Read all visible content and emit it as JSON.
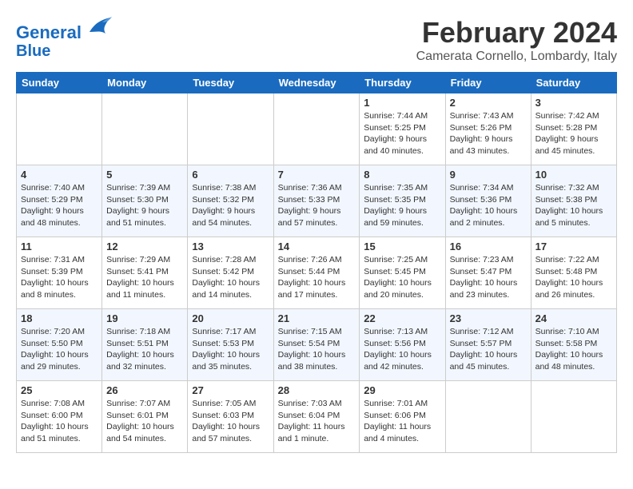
{
  "header": {
    "logo_line1": "General",
    "logo_line2": "Blue",
    "month": "February 2024",
    "location": "Camerata Cornello, Lombardy, Italy"
  },
  "weekdays": [
    "Sunday",
    "Monday",
    "Tuesday",
    "Wednesday",
    "Thursday",
    "Friday",
    "Saturday"
  ],
  "weeks": [
    [
      {
        "day": "",
        "info": ""
      },
      {
        "day": "",
        "info": ""
      },
      {
        "day": "",
        "info": ""
      },
      {
        "day": "",
        "info": ""
      },
      {
        "day": "1",
        "info": "Sunrise: 7:44 AM\nSunset: 5:25 PM\nDaylight: 9 hours\nand 40 minutes."
      },
      {
        "day": "2",
        "info": "Sunrise: 7:43 AM\nSunset: 5:26 PM\nDaylight: 9 hours\nand 43 minutes."
      },
      {
        "day": "3",
        "info": "Sunrise: 7:42 AM\nSunset: 5:28 PM\nDaylight: 9 hours\nand 45 minutes."
      }
    ],
    [
      {
        "day": "4",
        "info": "Sunrise: 7:40 AM\nSunset: 5:29 PM\nDaylight: 9 hours\nand 48 minutes."
      },
      {
        "day": "5",
        "info": "Sunrise: 7:39 AM\nSunset: 5:30 PM\nDaylight: 9 hours\nand 51 minutes."
      },
      {
        "day": "6",
        "info": "Sunrise: 7:38 AM\nSunset: 5:32 PM\nDaylight: 9 hours\nand 54 minutes."
      },
      {
        "day": "7",
        "info": "Sunrise: 7:36 AM\nSunset: 5:33 PM\nDaylight: 9 hours\nand 57 minutes."
      },
      {
        "day": "8",
        "info": "Sunrise: 7:35 AM\nSunset: 5:35 PM\nDaylight: 9 hours\nand 59 minutes."
      },
      {
        "day": "9",
        "info": "Sunrise: 7:34 AM\nSunset: 5:36 PM\nDaylight: 10 hours\nand 2 minutes."
      },
      {
        "day": "10",
        "info": "Sunrise: 7:32 AM\nSunset: 5:38 PM\nDaylight: 10 hours\nand 5 minutes."
      }
    ],
    [
      {
        "day": "11",
        "info": "Sunrise: 7:31 AM\nSunset: 5:39 PM\nDaylight: 10 hours\nand 8 minutes."
      },
      {
        "day": "12",
        "info": "Sunrise: 7:29 AM\nSunset: 5:41 PM\nDaylight: 10 hours\nand 11 minutes."
      },
      {
        "day": "13",
        "info": "Sunrise: 7:28 AM\nSunset: 5:42 PM\nDaylight: 10 hours\nand 14 minutes."
      },
      {
        "day": "14",
        "info": "Sunrise: 7:26 AM\nSunset: 5:44 PM\nDaylight: 10 hours\nand 17 minutes."
      },
      {
        "day": "15",
        "info": "Sunrise: 7:25 AM\nSunset: 5:45 PM\nDaylight: 10 hours\nand 20 minutes."
      },
      {
        "day": "16",
        "info": "Sunrise: 7:23 AM\nSunset: 5:47 PM\nDaylight: 10 hours\nand 23 minutes."
      },
      {
        "day": "17",
        "info": "Sunrise: 7:22 AM\nSunset: 5:48 PM\nDaylight: 10 hours\nand 26 minutes."
      }
    ],
    [
      {
        "day": "18",
        "info": "Sunrise: 7:20 AM\nSunset: 5:50 PM\nDaylight: 10 hours\nand 29 minutes."
      },
      {
        "day": "19",
        "info": "Sunrise: 7:18 AM\nSunset: 5:51 PM\nDaylight: 10 hours\nand 32 minutes."
      },
      {
        "day": "20",
        "info": "Sunrise: 7:17 AM\nSunset: 5:53 PM\nDaylight: 10 hours\nand 35 minutes."
      },
      {
        "day": "21",
        "info": "Sunrise: 7:15 AM\nSunset: 5:54 PM\nDaylight: 10 hours\nand 38 minutes."
      },
      {
        "day": "22",
        "info": "Sunrise: 7:13 AM\nSunset: 5:56 PM\nDaylight: 10 hours\nand 42 minutes."
      },
      {
        "day": "23",
        "info": "Sunrise: 7:12 AM\nSunset: 5:57 PM\nDaylight: 10 hours\nand 45 minutes."
      },
      {
        "day": "24",
        "info": "Sunrise: 7:10 AM\nSunset: 5:58 PM\nDaylight: 10 hours\nand 48 minutes."
      }
    ],
    [
      {
        "day": "25",
        "info": "Sunrise: 7:08 AM\nSunset: 6:00 PM\nDaylight: 10 hours\nand 51 minutes."
      },
      {
        "day": "26",
        "info": "Sunrise: 7:07 AM\nSunset: 6:01 PM\nDaylight: 10 hours\nand 54 minutes."
      },
      {
        "day": "27",
        "info": "Sunrise: 7:05 AM\nSunset: 6:03 PM\nDaylight: 10 hours\nand 57 minutes."
      },
      {
        "day": "28",
        "info": "Sunrise: 7:03 AM\nSunset: 6:04 PM\nDaylight: 11 hours\nand 1 minute."
      },
      {
        "day": "29",
        "info": "Sunrise: 7:01 AM\nSunset: 6:06 PM\nDaylight: 11 hours\nand 4 minutes."
      },
      {
        "day": "",
        "info": ""
      },
      {
        "day": "",
        "info": ""
      }
    ]
  ]
}
